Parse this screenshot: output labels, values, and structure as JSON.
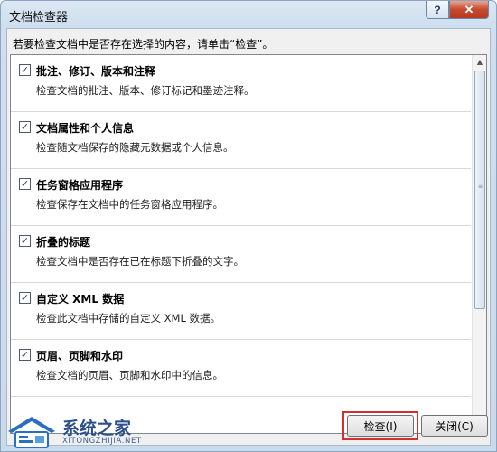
{
  "window": {
    "title": "文档检查器",
    "help_label": "?",
    "close_label": "✕"
  },
  "instruction": "若要检查文档中是否存在选择的内容，请单击“检查”。",
  "items": [
    {
      "title": "批注、修订、版本和注释",
      "description": "检查文档的批注、版本、修订标记和墨迹注释。",
      "checked": true
    },
    {
      "title": "文档属性和个人信息",
      "description": "检查随文档保存的隐藏元数据或个人信息。",
      "checked": true
    },
    {
      "title": "任务窗格应用程序",
      "description": "检查保存在文档中的任务窗格应用程序。",
      "checked": true
    },
    {
      "title": "折叠的标题",
      "description": "检查文档中是否存在已在标题下折叠的文字。",
      "checked": true
    },
    {
      "title": "自定义 XML 数据",
      "description": "检查此文档中存储的自定义 XML 数据。",
      "checked": true
    },
    {
      "title": "页眉、页脚和水印",
      "description": "检查文档的页眉、页脚和水印中的信息。",
      "checked": true
    }
  ],
  "checkbox_mark": "✓",
  "scrollbar": {
    "up_arrow": "▲",
    "down_arrow": "▼",
    "grip": "≡"
  },
  "buttons": {
    "inspect_label": "检查(I)",
    "close_label": "关闭(C)"
  },
  "watermark": {
    "name": "系统之家",
    "url": "XITONGZHIJIA.NET"
  },
  "colors": {
    "highlight": "#d22f2f",
    "close_button": "#c44a2e",
    "brand": "#2a4f8a"
  }
}
